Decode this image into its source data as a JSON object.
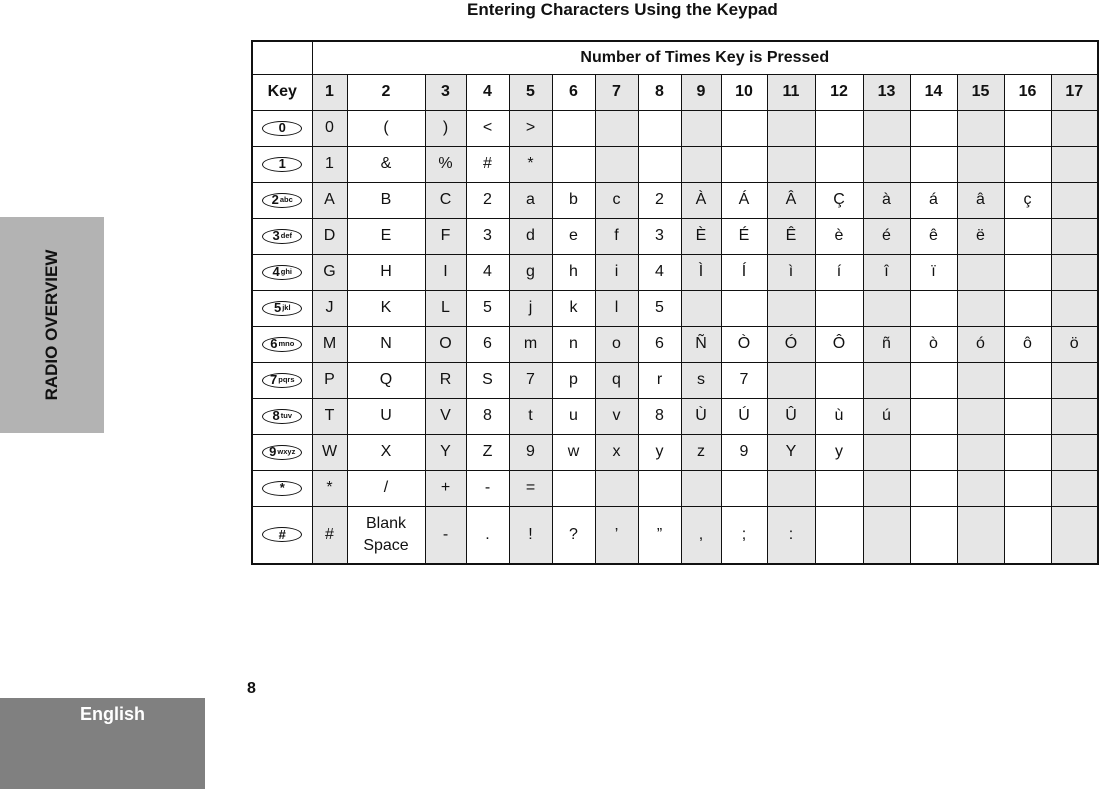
{
  "page": {
    "title": "Entering Characters Using the Keypad",
    "side_tab": "RADIO OVERVIEW",
    "language_tab": "English",
    "page_number": "8",
    "shade_color": "#e6e6e6",
    "side_tab_color": "#b3b3b3",
    "language_tab_color": "#808080"
  },
  "table": {
    "span_header": "Number of Times Key is Pressed",
    "key_header": "Key",
    "press_counts": [
      "1",
      "2",
      "3",
      "4",
      "5",
      "6",
      "7",
      "8",
      "9",
      "10",
      "11",
      "12",
      "13",
      "14",
      "15",
      "16",
      "17"
    ],
    "rows": [
      {
        "key": {
          "digit": "0",
          "letters": "",
          "icon": "key-0-icon"
        },
        "chars": [
          "0",
          "(",
          ")",
          "<",
          ">",
          "",
          "",
          "",
          "",
          "",
          "",
          "",
          "",
          "",
          "",
          "",
          ""
        ]
      },
      {
        "key": {
          "digit": "1",
          "letters": "",
          "icon": "key-1-icon"
        },
        "chars": [
          "1",
          "&",
          "%",
          "#",
          "*",
          "",
          "",
          "",
          "",
          "",
          "",
          "",
          "",
          "",
          "",
          "",
          ""
        ]
      },
      {
        "key": {
          "digit": "2",
          "letters": "abc",
          "icon": "key-2-icon"
        },
        "chars": [
          "A",
          "B",
          "C",
          "2",
          "a",
          "b",
          "c",
          "2",
          "À",
          "Á",
          "Â",
          "Ç",
          "à",
          "á",
          "â",
          "ç",
          ""
        ]
      },
      {
        "key": {
          "digit": "3",
          "letters": "def",
          "icon": "key-3-icon"
        },
        "chars": [
          "D",
          "E",
          "F",
          "3",
          "d",
          "e",
          "f",
          "3",
          "È",
          "É",
          "Ê",
          "è",
          "é",
          "ê",
          "ë",
          "",
          ""
        ]
      },
      {
        "key": {
          "digit": "4",
          "letters": "ghi",
          "icon": "key-4-icon"
        },
        "chars": [
          "G",
          "H",
          "I",
          "4",
          "g",
          "h",
          "i",
          "4",
          "Ì",
          "Í",
          "ì",
          "í",
          "î",
          "ï",
          "",
          "",
          ""
        ]
      },
      {
        "key": {
          "digit": "5",
          "letters": "jkl",
          "icon": "key-5-icon"
        },
        "chars": [
          "J",
          "K",
          "L",
          "5",
          "j",
          "k",
          "l",
          "5",
          "",
          "",
          "",
          "",
          "",
          "",
          "",
          "",
          ""
        ]
      },
      {
        "key": {
          "digit": "6",
          "letters": "mno",
          "icon": "key-6-icon"
        },
        "chars": [
          "M",
          "N",
          "O",
          "6",
          "m",
          "n",
          "o",
          "6",
          "Ñ",
          "Ò",
          "Ó",
          "Ô",
          "ñ",
          "ò",
          "ó",
          "ô",
          "ö"
        ]
      },
      {
        "key": {
          "digit": "7",
          "letters": "pqrs",
          "icon": "key-7-icon"
        },
        "chars": [
          "P",
          "Q",
          "R",
          "S",
          "7",
          "p",
          "q",
          "r",
          "s",
          "7",
          "",
          "",
          "",
          "",
          "",
          "",
          ""
        ]
      },
      {
        "key": {
          "digit": "8",
          "letters": "tuv",
          "icon": "key-8-icon"
        },
        "chars": [
          "T",
          "U",
          "V",
          "8",
          "t",
          "u",
          "v",
          "8",
          "Ù",
          "Ú",
          "Û",
          "ù",
          "ú",
          "",
          "",
          "",
          ""
        ]
      },
      {
        "key": {
          "digit": "9",
          "letters": "wxyz",
          "icon": "key-9-icon"
        },
        "chars": [
          "W",
          "X",
          "Y",
          "Z",
          "9",
          "w",
          "x",
          "y",
          "z",
          "9",
          "Y",
          "y",
          "",
          "",
          "",
          "",
          ""
        ]
      },
      {
        "key": {
          "digit": "*",
          "letters": "",
          "icon": "key-star-icon"
        },
        "chars": [
          "*",
          "/",
          "+",
          "-",
          "=",
          "",
          "",
          "",
          "",
          "",
          "",
          "",
          "",
          "",
          "",
          "",
          ""
        ]
      },
      {
        "key": {
          "digit": "#",
          "letters": "",
          "icon": "key-pound-icon"
        },
        "chars": [
          "#",
          "Blank\nSpace",
          "-",
          ".",
          "!",
          "?",
          "’",
          "”",
          ",",
          ";",
          ":",
          "",
          "",
          "",
          "",
          "",
          ""
        ]
      }
    ]
  }
}
